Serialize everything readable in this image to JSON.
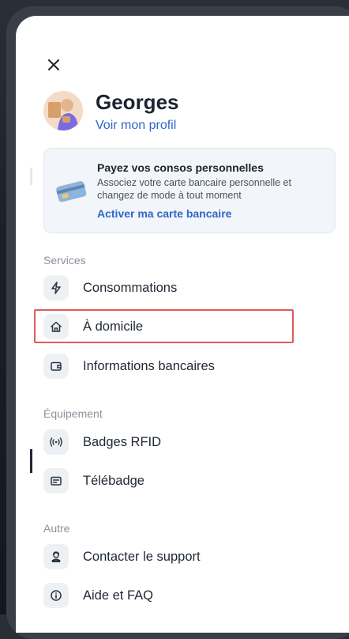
{
  "profile": {
    "name": "Georges",
    "link": "Voir mon profil"
  },
  "promo": {
    "title": "Payez vos consos personnelles",
    "description": "Associez votre carte bancaire personnelle et changez de mode à tout moment",
    "link": "Activer ma carte bancaire"
  },
  "sections": {
    "services": {
      "title": "Services",
      "items": [
        {
          "label": "Consommations",
          "icon": "lightning-icon"
        },
        {
          "label": "À domicile",
          "icon": "home-icon"
        },
        {
          "label": "Informations bancaires",
          "icon": "wallet-icon"
        }
      ]
    },
    "equipement": {
      "title": "Équipement",
      "items": [
        {
          "label": "Badges RFID",
          "icon": "rfid-icon"
        },
        {
          "label": "Télébadge",
          "icon": "badge-card-icon"
        }
      ]
    },
    "autre": {
      "title": "Autre",
      "items": [
        {
          "label": "Contacter le support",
          "icon": "support-icon"
        },
        {
          "label": "Aide et FAQ",
          "icon": "info-icon"
        }
      ]
    }
  },
  "colors": {
    "accent": "#2f67c9",
    "highlight": "#e05a5a",
    "icon_bg": "#eef1f4"
  }
}
